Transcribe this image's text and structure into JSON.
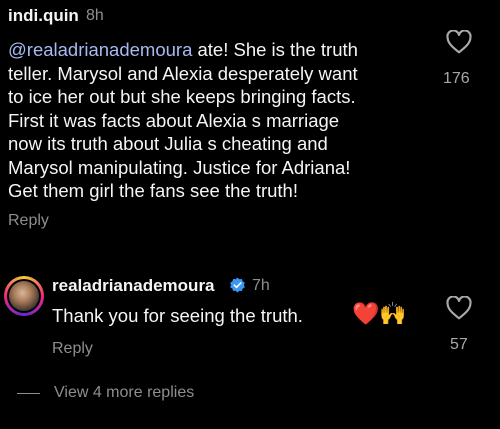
{
  "comment": {
    "username": "indi.quin",
    "time": "8h",
    "mention": "@realadrianademoura",
    "lines": [
      " ate! She is the truth",
      "teller. Marysol and Alexia desperately want",
      "to ice her out but she keeps bringing facts.",
      "First it was facts about Alexia s marriage",
      "now its truth about Julia s cheating and",
      "Marysol manipulating.  Justice for Adriana!",
      "Get them girl the fans see the truth!"
    ],
    "likes": "176",
    "reply_label": "Reply"
  },
  "reply": {
    "username": "realadrianademoura",
    "time": "7h",
    "text": "Thank you for seeing the truth.",
    "emojis": "❤️🙌",
    "likes": "57",
    "reply_label": "Reply"
  },
  "view_more": "View 4 more replies",
  "colors": {
    "background": "#000000",
    "text": "#f5f5f5",
    "muted": "#8e8e8e",
    "mention": "#a7b9f2",
    "verified": "#3897f0"
  },
  "icons": [
    "heart-icon",
    "verified-badge-icon"
  ]
}
